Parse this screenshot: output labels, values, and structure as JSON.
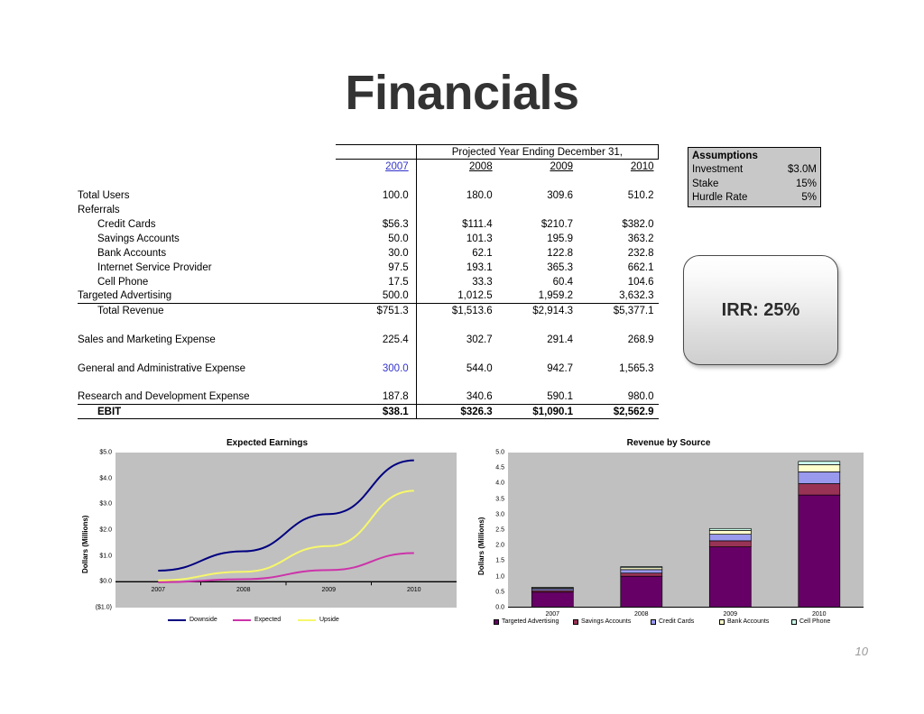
{
  "slide": {
    "title": "Financials",
    "page_number": "10"
  },
  "table": {
    "header_projected": "Projected Year Ending December 31,",
    "years": [
      "2007",
      "2008",
      "2009",
      "2010"
    ],
    "rows": [
      {
        "label": "Total Users",
        "indent": 0,
        "values": [
          "100.0",
          "180.0",
          "309.6",
          "510.2"
        ]
      },
      {
        "label": "Referrals",
        "indent": 0,
        "values": [
          "",
          "",
          "",
          ""
        ]
      },
      {
        "label": "Credit Cards",
        "indent": 1,
        "values": [
          "$56.3",
          "$111.4",
          "$210.7",
          "$382.0"
        ]
      },
      {
        "label": "Savings Accounts",
        "indent": 1,
        "values": [
          "50.0",
          "101.3",
          "195.9",
          "363.2"
        ]
      },
      {
        "label": "Bank Accounts",
        "indent": 1,
        "values": [
          "30.0",
          "62.1",
          "122.8",
          "232.8"
        ]
      },
      {
        "label": "Internet Service Provider",
        "indent": 1,
        "values": [
          "97.5",
          "193.1",
          "365.3",
          "662.1"
        ]
      },
      {
        "label": "Cell Phone",
        "indent": 1,
        "values": [
          "17.5",
          "33.3",
          "60.4",
          "104.6"
        ]
      },
      {
        "label": "Targeted Advertising",
        "indent": 0,
        "values": [
          "500.0",
          "1,012.5",
          "1,959.2",
          "3,632.3"
        ]
      },
      {
        "label": "Total Revenue",
        "indent": 1,
        "values": [
          "$751.3",
          "$1,513.6",
          "$2,914.3",
          "$5,377.1"
        ]
      },
      {
        "label": "Sales and Marketing Expense",
        "indent": 0,
        "values": [
          "225.4",
          "302.7",
          "291.4",
          "268.9"
        ]
      },
      {
        "label": "General and Administrative Expense",
        "indent": 0,
        "values": [
          "300.0",
          "544.0",
          "942.7",
          "1,565.3"
        ]
      },
      {
        "label": "Research and Development Expense",
        "indent": 0,
        "values": [
          "187.8",
          "340.6",
          "590.1",
          "980.0"
        ]
      },
      {
        "label": "EBIT",
        "indent": 1,
        "values": [
          "$38.1",
          "$326.3",
          "$1,090.1",
          "$2,562.9"
        ]
      }
    ]
  },
  "assumptions": {
    "title": "Assumptions",
    "items": [
      {
        "label": "Investment",
        "value": "$3.0M"
      },
      {
        "label": "Stake",
        "value": "15%"
      },
      {
        "label": "Hurdle Rate",
        "value": "5%"
      }
    ]
  },
  "irr": {
    "label": "IRR: 25%"
  },
  "chart_data": [
    {
      "type": "line",
      "title": "Expected Earnings",
      "xlabel": "",
      "ylabel": "Dollars (Millions)",
      "x": [
        "2007",
        "2008",
        "2009",
        "2010"
      ],
      "ylim": [
        -1.0,
        5.0
      ],
      "ytick_labels": [
        "$5.0",
        "$4.0",
        "$3.0",
        "$2.0",
        "$1.0",
        "$0.0",
        "($1.0)"
      ],
      "ytick_values": [
        5.0,
        4.0,
        3.0,
        2.0,
        1.0,
        0.0,
        -1.0
      ],
      "grid": false,
      "legend_position": "bottom",
      "plot_background": "#c0c0c0",
      "series": [
        {
          "name": "Downside",
          "color": "#000080",
          "values": [
            0.43,
            1.18,
            2.62,
            4.7
          ]
        },
        {
          "name": "Expected",
          "color": "#cc33aa",
          "values": [
            -0.02,
            0.1,
            0.45,
            1.11
          ]
        },
        {
          "name": "Upside",
          "color": "#f7f76b",
          "values": [
            0.05,
            0.39,
            1.38,
            3.52
          ]
        }
      ]
    },
    {
      "type": "bar",
      "title": "Revenue by Source",
      "subtype": "stacked",
      "xlabel": "",
      "ylabel": "Dollars (Millions)",
      "categories": [
        "2007",
        "2008",
        "2009",
        "2010"
      ],
      "ylim": [
        0.0,
        5.0
      ],
      "ytick_labels": [
        "5.0",
        "4.5",
        "4.0",
        "3.5",
        "3.0",
        "2.5",
        "2.0",
        "1.5",
        "1.0",
        "0.5",
        "0.0"
      ],
      "ytick_values": [
        5.0,
        4.5,
        4.0,
        3.5,
        3.0,
        2.5,
        2.0,
        1.5,
        1.0,
        0.5,
        0.0
      ],
      "grid": false,
      "legend_position": "bottom",
      "plot_background": "#c0c0c0",
      "series": [
        {
          "name": "Targeted Advertising",
          "color": "#660066",
          "values": [
            0.5,
            1.013,
            1.959,
            3.632
          ]
        },
        {
          "name": "Savings Accounts",
          "color": "#993355",
          "values": [
            0.05,
            0.101,
            0.196,
            0.363
          ]
        },
        {
          "name": "Credit Cards",
          "color": "#9999ee",
          "values": [
            0.056,
            0.111,
            0.211,
            0.382
          ]
        },
        {
          "name": "Bank Accounts",
          "color": "#ffffcc",
          "values": [
            0.03,
            0.062,
            0.123,
            0.233
          ]
        },
        {
          "name": "Cell Phone",
          "color": "#ccffee",
          "values": [
            0.018,
            0.033,
            0.06,
            0.105
          ]
        }
      ]
    }
  ]
}
